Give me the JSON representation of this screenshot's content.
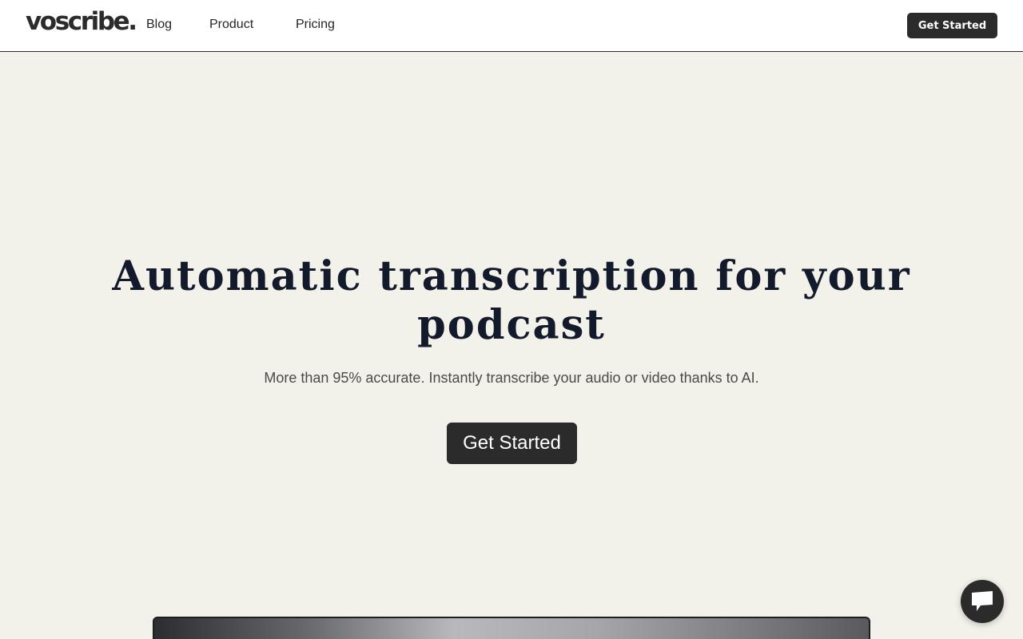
{
  "nav": {
    "logo": "voscribe.",
    "links": [
      "Blog",
      "Product",
      "Pricing"
    ],
    "cta_label": "Get Started"
  },
  "hero": {
    "title": "Automatic transcription for your podcast",
    "subtitle": "More than 95% accurate. Instantly transcribe your audio or video thanks to AI.",
    "cta_label": "Get Started"
  },
  "widgets": {
    "chat_icon": "chat-bubble-icon"
  },
  "colors": {
    "background": "#f3f2ea",
    "button": "#2b2b2b",
    "heading": "#131a2b",
    "subtitle": "#4a4a4a"
  }
}
